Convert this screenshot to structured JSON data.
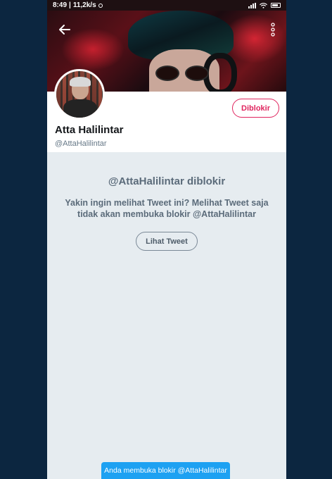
{
  "status_bar": {
    "time": "8:49",
    "net_speed": "11,2k/s"
  },
  "header": {
    "back_icon": "arrow-left-icon",
    "more_icon": "more-vertical-icon"
  },
  "profile": {
    "display_name": "Atta Halilintar",
    "handle": "@AttaHalilintar",
    "blocked_button_label": "Diblokir"
  },
  "blocked_notice": {
    "title": "@AttaHalilintar diblokir",
    "description": "Yakin ingin melihat Tweet ini? Melihat Tweet saja tidak akan membuka blokir @AttaHalilintar",
    "view_button_label": "Lihat Tweet"
  },
  "toast": {
    "message": "Anda membuka blokir @AttaHalilintar"
  },
  "colors": {
    "accent": "#1da1f2",
    "blocked_red": "#e0245e",
    "page_background": "#0c2640"
  }
}
